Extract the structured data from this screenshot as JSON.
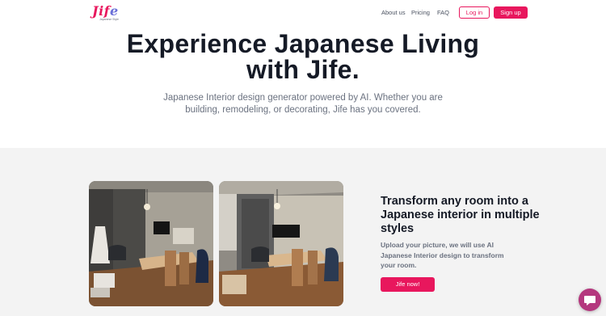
{
  "header": {
    "logo": {
      "text_j": "Ji",
      "text_f": "f",
      "text_e": "e",
      "tagline": "Japanese Style"
    },
    "nav": {
      "about": "About us",
      "pricing": "Pricing",
      "faq": "FAQ"
    },
    "login_label": "Log in",
    "signup_label": "Sign up"
  },
  "hero": {
    "title": "Experience Japanese Living with Jife.",
    "subtitle": "Japanese Interior design generator powered by AI. Whether you are building, remodeling, or decorating, Jife has you covered."
  },
  "feature": {
    "title": "Transform any room into a Japanese interior in multiple styles",
    "description": "Upload your picture, we will use AI Japanese Interior design to transform your room.",
    "cta_label": "Jife now!"
  },
  "chat": {
    "icon": "chat-bubble-icon"
  },
  "colors": {
    "brand": "#e8175d",
    "chat": "#b4377e",
    "section_bg": "#f3f3f3"
  }
}
